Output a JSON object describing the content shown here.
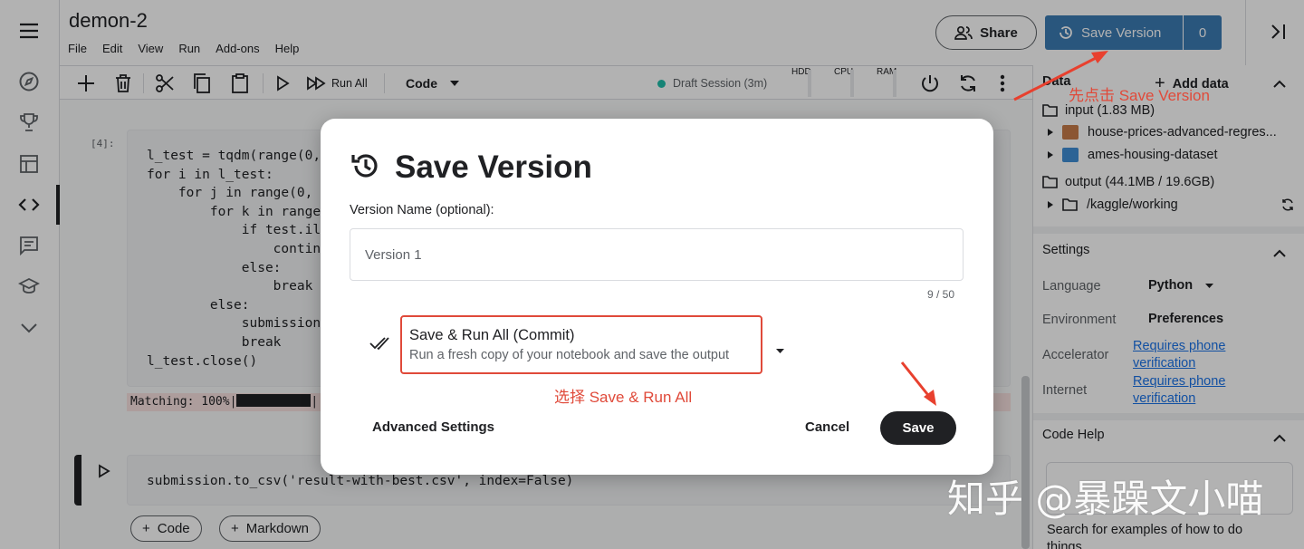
{
  "notebook": {
    "title": "demon-2",
    "menu": [
      "File",
      "Edit",
      "View",
      "Run",
      "Add-ons",
      "Help"
    ]
  },
  "header": {
    "share_label": "Share",
    "save_version_label": "Save Version",
    "save_version_count": "0"
  },
  "toolbar": {
    "run_all_label": "Run All",
    "cell_type": "Code",
    "session_status": "Draft Session (3m)",
    "meters": [
      "HDD",
      "CPU",
      "RAM"
    ],
    "session_color": "#20beaa"
  },
  "cells": {
    "cell1_number": "[4]:",
    "cell1_lines": [
      "l_test = tqdm(range(0,",
      "for i in l_test:",
      "    for j in range(0,",
      "        for k in range",
      "            if test.il",
      "                contin",
      "            else:",
      "                break",
      "        else:",
      "            submission",
      "            break",
      "l_test.close()"
    ],
    "cell1_output_prefix": "Matching: 100%|",
    "cell1_output_suffix": "|",
    "cell2_code": "submission.to_csv('result-with-best.csv', index=False)",
    "add_code_label": "Code",
    "add_markdown_label": "Markdown"
  },
  "panel": {
    "data_header": "Data",
    "add_data_label": "Add data",
    "input_label": "input (1.83 MB)",
    "datasets": [
      "house-prices-advanced-regres...",
      "ames-housing-dataset"
    ],
    "output_label": "output (44.1MB / 19.6GB)",
    "working_dir": "/kaggle/working",
    "settings_header": "Settings",
    "settings": {
      "language_label": "Language",
      "language_value": "Python",
      "environment_label": "Environment",
      "environment_value": "Preferences",
      "accelerator_label": "Accelerator",
      "accelerator_value_1": "Requires phone",
      "accelerator_value_2": "verification",
      "internet_label": "Internet",
      "internet_value_1": "Requires phone",
      "internet_value_2": "verification"
    },
    "code_help_header": "Code Help",
    "code_help_text_1": "Search for examples of how to do",
    "code_help_text_2": "things"
  },
  "modal": {
    "title": "Save Version",
    "version_name_label": "Version Name (optional):",
    "version_name_value": "Version 1",
    "char_counter": "9 / 50",
    "option_title": "Save & Run All (Commit)",
    "option_subtitle": "Run a fresh copy of your notebook and save the output",
    "advanced_label": "Advanced Settings",
    "cancel_label": "Cancel",
    "save_label": "Save"
  },
  "annotations": {
    "top_note": "先点击 Save Version",
    "run_all_note": "选择 Save & Run All",
    "watermark": "知乎 @暴躁文小喵",
    "annotation_color": "#e04a3a"
  },
  "colors": {
    "primary_blue": "#3b7bb3",
    "dark": "#202124",
    "link": "#1a73e8"
  }
}
